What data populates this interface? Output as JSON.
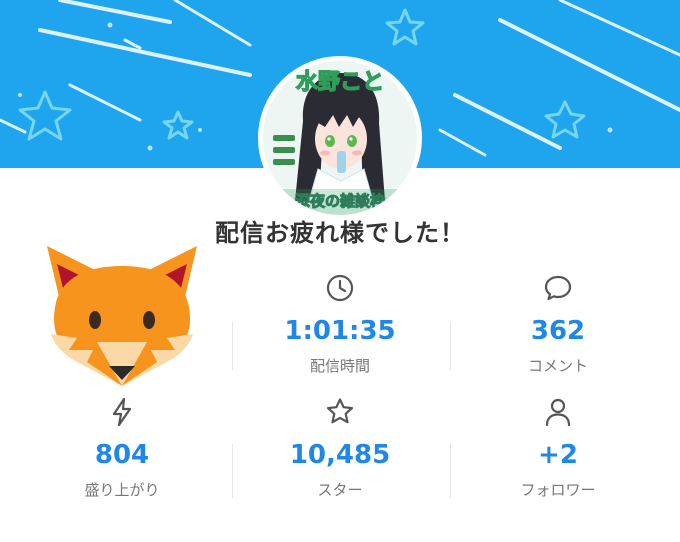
{
  "banner": {
    "avatar_text_top": "水野こと",
    "avatar_text_bottom": "深夜の雑談枠",
    "accent_color": "#1fa5ee"
  },
  "summary": {
    "title": "配信お疲れ様でした！"
  },
  "stats": [
    {
      "icon": "clock-icon",
      "value": "1:01:35",
      "label": "配信時間"
    },
    {
      "icon": "comment-icon",
      "value": "362",
      "label": "コメント"
    },
    {
      "icon": "lightning-icon",
      "value": "804",
      "label": "盛り上がり"
    },
    {
      "icon": "star-icon",
      "value": "10,485",
      "label": "スター"
    },
    {
      "icon": "person-icon",
      "value": "+2",
      "label": "フォロワー"
    }
  ],
  "colors": {
    "value_blue": "#1f87e8",
    "label_gray": "#777777",
    "fox_orange": "#f7941d"
  }
}
